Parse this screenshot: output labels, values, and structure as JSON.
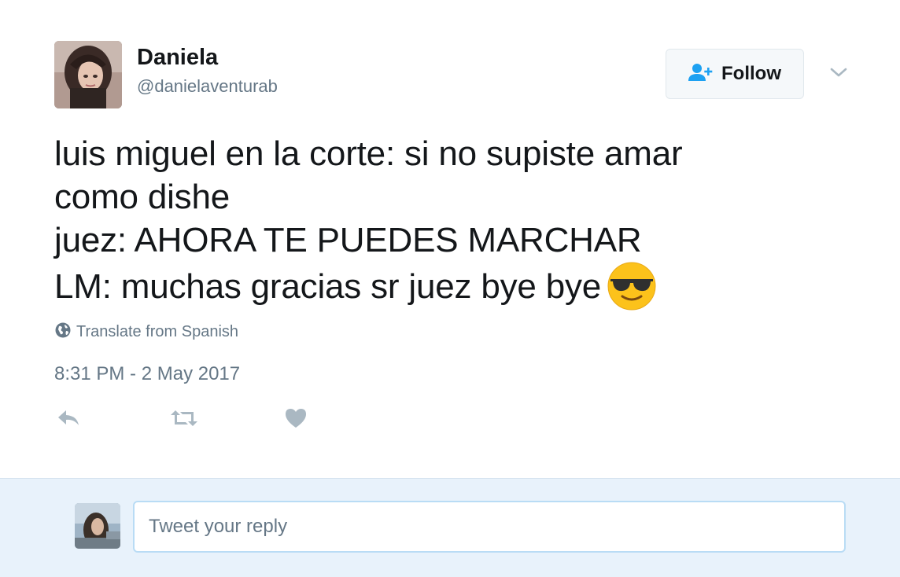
{
  "user": {
    "name": "Daniela",
    "handle": "@danielaventurab"
  },
  "follow_button": {
    "label": "Follow",
    "icon": "follow-person-plus-icon"
  },
  "more_menu": {
    "icon": "chevron-down-icon"
  },
  "tweet": {
    "lines": [
      "luis miguel en la corte: si no supiste amar",
      "como dishe",
      "juez: AHORA TE PUEDES MARCHAR",
      "LM: muchas gracias sr juez bye bye"
    ],
    "emoji": "smiling-face-with-sunglasses"
  },
  "translate": {
    "label": "Translate from Spanish",
    "icon": "globe-icon"
  },
  "timestamp": "8:31 PM - 2 May 2017",
  "actions": {
    "reply_icon": "reply-icon",
    "retweet_icon": "retweet-icon",
    "like_icon": "heart-icon"
  },
  "reply_box": {
    "placeholder": "Tweet your reply"
  },
  "colors": {
    "accent": "#1da1f2",
    "muted": "#657786",
    "reply_bar_bg": "#e8f2fb",
    "action_icon": "#aab8c2"
  }
}
